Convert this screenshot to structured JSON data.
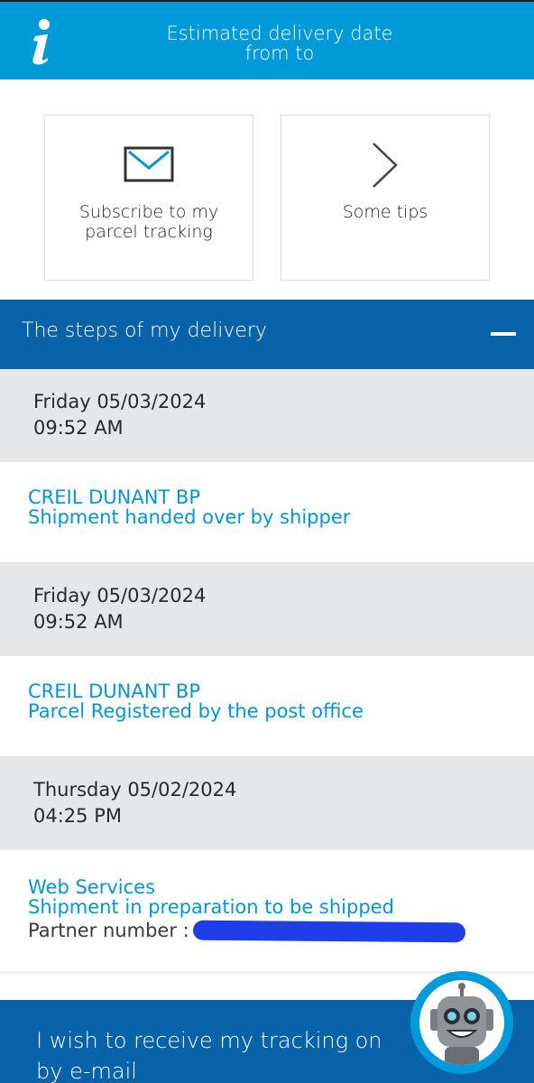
{
  "banner": {
    "icon": "info-icon",
    "line1": "Estimated delivery date",
    "line2": "from to"
  },
  "cards": [
    {
      "icon": "envelope-icon",
      "label": "Subscribe to my parcel tracking"
    },
    {
      "icon": "chevron-right-icon",
      "label": "Some tips"
    }
  ],
  "steps_header": {
    "title": "The steps of my delivery",
    "collapse_icon": "minus-icon"
  },
  "steps": [
    {
      "day_date": "Friday 05/03/2024",
      "time": "09:52 AM",
      "location": "CREIL DUNANT BP",
      "description": "Shipment handed over by shipper"
    },
    {
      "day_date": "Friday 05/03/2024",
      "time": "09:52 AM",
      "location": "CREIL DUNANT BP",
      "description": "Parcel Registered by the post office"
    },
    {
      "day_date": "Thursday 05/02/2024",
      "time": "04:25 PM",
      "location": "Web Services",
      "description": "Shipment in preparation to be shipped",
      "partner_label": "Partner number :"
    }
  ],
  "bottom": {
    "line1": "I wish to receive my tracking on",
    "line2": "by e-mail"
  },
  "bot": {
    "icon": "chatbot-robot-icon"
  },
  "colors": {
    "banner_blue": "#009ad8",
    "header_blue": "#0863a9",
    "link_blue": "#0095d4",
    "date_bg": "#e6e7e9"
  }
}
